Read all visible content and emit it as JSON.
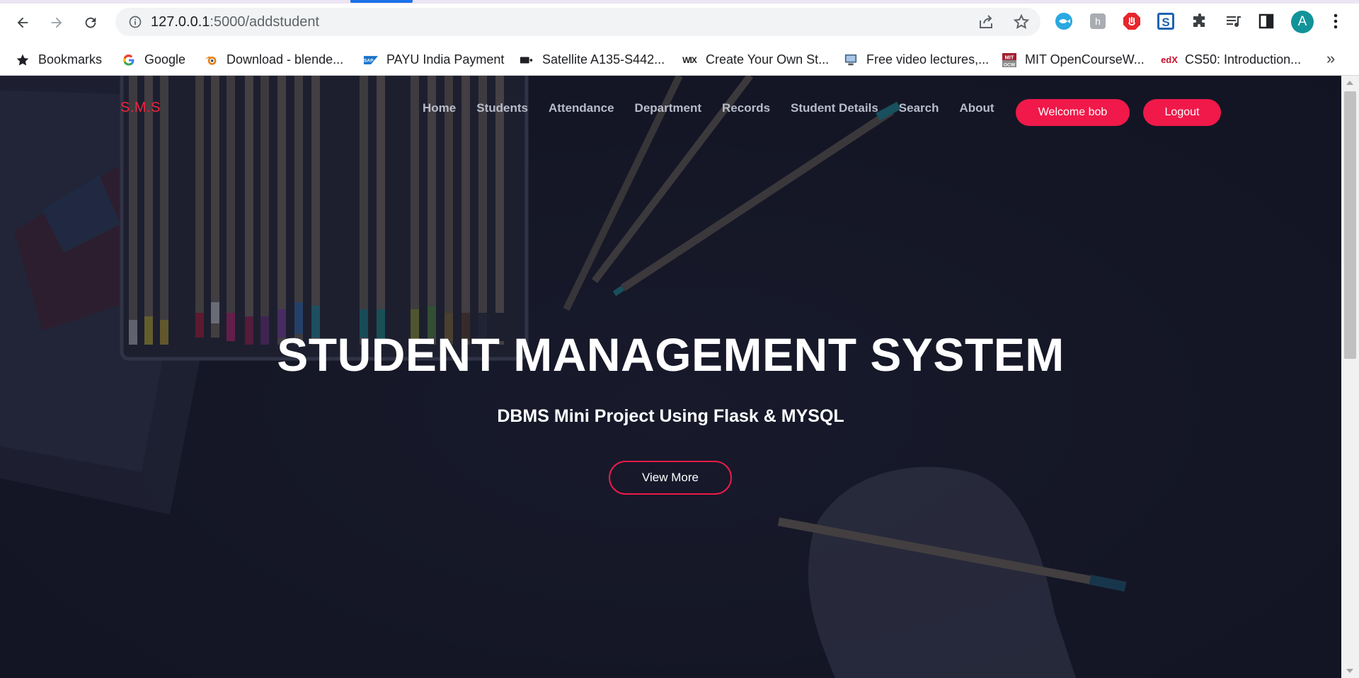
{
  "browser": {
    "url_host": "127.0.0.1",
    "url_rest": ":5000/addstudent",
    "profile_initial": "A",
    "bookmarks": [
      {
        "label": "Bookmarks",
        "icon": "star-icon"
      },
      {
        "label": "Google",
        "icon": "google-icon"
      },
      {
        "label": "Download - blende...",
        "icon": "blender-icon"
      },
      {
        "label": "PAYU India Payment",
        "icon": "sap-icon"
      },
      {
        "label": "Satellite A135-S442...",
        "icon": "satellite-icon"
      },
      {
        "label": "Create Your Own St...",
        "icon": "wix-icon"
      },
      {
        "label": "Free video lectures,...",
        "icon": "monitor-icon"
      },
      {
        "label": "MIT OpenCourseW...",
        "icon": "mit-icon"
      },
      {
        "label": "CS50: Introduction...",
        "icon": "edx-icon"
      }
    ],
    "more_label": "»"
  },
  "site": {
    "brand": "S.M.S",
    "nav": [
      "Home",
      "Students",
      "Attendance",
      "Department",
      "Records",
      "Student Details",
      "Search",
      "About"
    ],
    "welcome_label": "Welcome bob",
    "logout_label": "Logout",
    "hero_title": "STUDENT MANAGEMENT SYSTEM",
    "hero_subtitle": "DBMS Mini Project Using Flask & MYSQL",
    "cta_label": "View More",
    "accent_color": "#f0194a"
  }
}
